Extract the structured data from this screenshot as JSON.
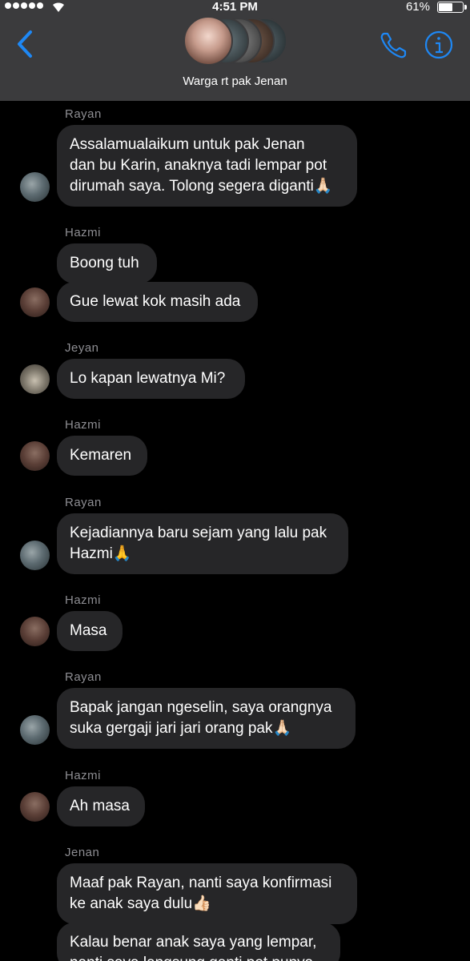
{
  "status_bar": {
    "time": "4:51 PM",
    "battery_percent_label": "61%",
    "battery_level": 0.61
  },
  "header": {
    "group_name": "Warga rt pak Jenan"
  },
  "messages": [
    {
      "sender": "Rayan",
      "texts": [
        "Assalamualaikum untuk pak Jenan\ndan bu Karin, anaknya tadi lempar pot\ndirumah saya. Tolong segera diganti🙏🏻"
      ]
    },
    {
      "sender": "Hazmi",
      "texts": [
        "Boong tuh",
        "Gue lewat kok masih ada"
      ]
    },
    {
      "sender": "Jeyan",
      "texts": [
        "Lo kapan lewatnya Mi?"
      ]
    },
    {
      "sender": "Hazmi",
      "texts": [
        "Kemaren"
      ]
    },
    {
      "sender": "Rayan",
      "texts": [
        "Kejadiannya baru sejam yang lalu pak\nHazmi🙏"
      ]
    },
    {
      "sender": "Hazmi",
      "texts": [
        "Masa"
      ]
    },
    {
      "sender": "Rayan",
      "texts": [
        "Bapak jangan ngeselin, saya orangnya\nsuka gergaji jari jari orang pak🙏🏻"
      ]
    },
    {
      "sender": "Hazmi",
      "texts": [
        "Ah masa"
      ]
    },
    {
      "sender": "Jenan",
      "texts": [
        "Maaf pak Rayan, nanti saya konfirmasi\nke anak saya dulu👍🏻",
        "Kalau benar anak saya yang lempar,\nnanti saya langsung ganti pot punya"
      ]
    }
  ]
}
